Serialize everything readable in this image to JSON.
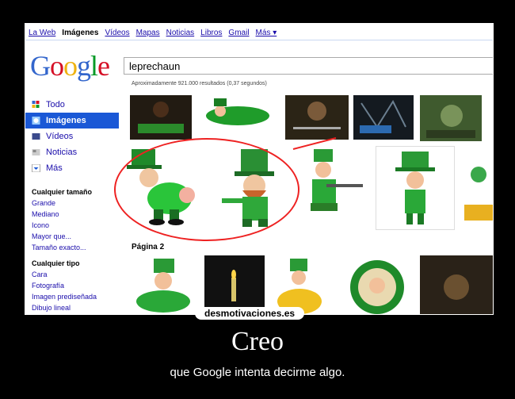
{
  "nav": [
    "La Web",
    "Imágenes",
    "Vídeos",
    "Mapas",
    "Noticias",
    "Libros",
    "Gmail",
    "Más ▾"
  ],
  "logo": "Google",
  "search": {
    "value": "leprechaun"
  },
  "results": "Aproximadamente 921.000 resultados (0,37 segundos)",
  "sidebar": {
    "items": [
      {
        "label": "Todo",
        "icon": "grid-icon"
      },
      {
        "label": "Imágenes",
        "icon": "image-icon"
      },
      {
        "label": "Vídeos",
        "icon": "video-icon"
      },
      {
        "label": "Noticias",
        "icon": "news-icon"
      },
      {
        "label": "Más",
        "icon": "chevron-down-icon"
      }
    ]
  },
  "filters": {
    "size_header": "Cualquier tamaño",
    "sizes": [
      "Grande",
      "Mediano",
      "Icono",
      "Mayor que...",
      "Tamaño exacto..."
    ],
    "type_header": "Cualquier tipo",
    "types": [
      "Cara",
      "Fotografía",
      "Imagen prediseñada",
      "Dibujo lineal"
    ]
  },
  "page2": "Página 2",
  "watermark": "desmotivaciones.es",
  "caption": "Creo",
  "subcaption": "que Google intenta decirme algo.",
  "colors": {
    "brand_blue": "#1a58d6",
    "circle_red": "#e22"
  }
}
